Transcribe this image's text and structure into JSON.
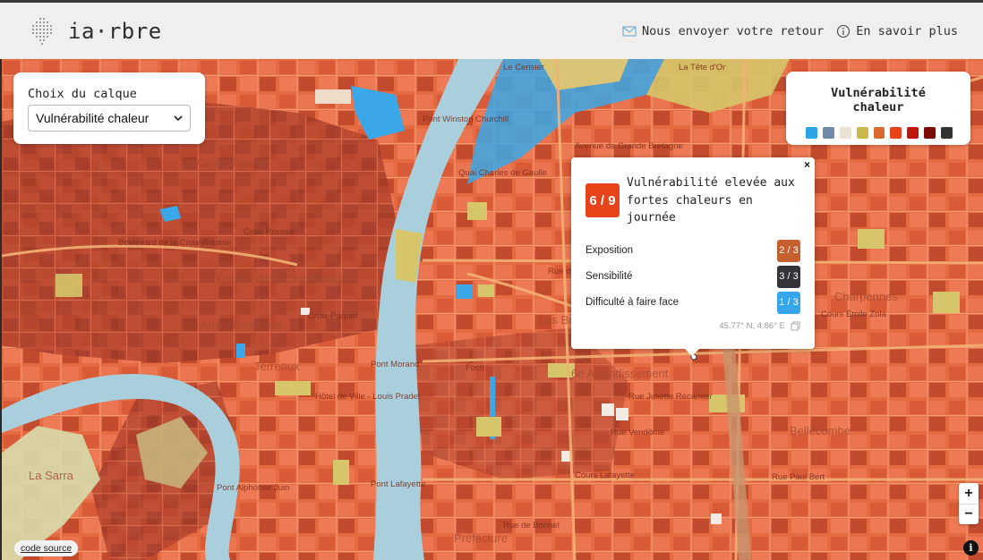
{
  "header": {
    "brand": "ia·rbre",
    "feedback_label": "Nous envoyer votre retour",
    "about_label": "En savoir plus"
  },
  "layer_panel": {
    "title": "Choix du calque",
    "selected": "Vulnérabilité chaleur"
  },
  "legend": {
    "title": "Vulnérabilité chaleur",
    "colors": [
      "#2aa5e8",
      "#6f8aa6",
      "#ece2d4",
      "#cbb84a",
      "#d76a2c",
      "#e8431a",
      "#c0160c",
      "#7a0b06",
      "#333333"
    ]
  },
  "popup": {
    "score": "6 / 9",
    "score_color": "#e8431a",
    "title": "Vulnérabilité elevée aux fortes chaleurs en journée",
    "rows": [
      {
        "label": "Exposition",
        "value": "2 / 3",
        "color": "#c6612f"
      },
      {
        "label": "Sensibilité",
        "value": "3 / 3",
        "color": "#343438"
      },
      {
        "label": "Difficulté à faire face",
        "value": "1 / 3",
        "color": "#35a6ea"
      }
    ],
    "coords": "45.77° N, 4.86° E",
    "close": "×"
  },
  "map_labels": {
    "districts": [
      "La Croix-Rousse",
      "Pentes de la Croix-Rousse",
      "1er Arrondissement",
      "Terreaux",
      "6e Arrondissement",
      "Les Brotteaux",
      "Bellecombe",
      "Charpennes",
      "Préfecture",
      "La Sarra"
    ],
    "places": [
      "Pont Winston Churchill",
      "Pont Morand",
      "Pont Lafayette",
      "Pont Alphonse Juin",
      "Hôtel de Ville - Louis Pradel",
      "Croix-Paquet",
      "Foch",
      "Croix Rousse",
      "Le Cerisier",
      "La Tête d'Or"
    ],
    "streets": [
      "Boulevard de la Croix-Rousse",
      "Rue de Sèze",
      "Rue Vendôme",
      "Cours Lafayette",
      "Rue de Bonnel",
      "Rue Juliette Récamier",
      "Avenue de Grande Bretagne",
      "Quai Charles de Gaulle",
      "Cours Émile Zola",
      "Rue Paul Bert"
    ]
  },
  "controls": {
    "zoom_in": "+",
    "zoom_out": "−",
    "code_source": "code source",
    "info": "i"
  }
}
